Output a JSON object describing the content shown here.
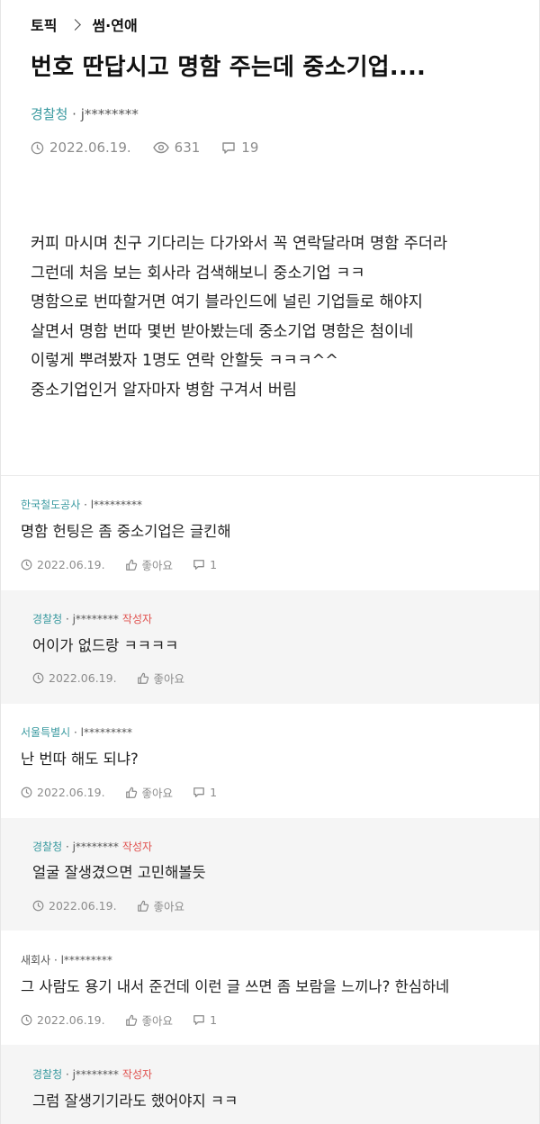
{
  "breadcrumb": {
    "root": "토픽",
    "current": "썸·연애"
  },
  "post": {
    "title": "번호 딴답시고 명함 주는데 중소기업....",
    "company": "경찰청",
    "separator": " · ",
    "user": "j********",
    "date": "2022.06.19.",
    "views": "631",
    "comments": "19",
    "body": [
      "커피 마시며 친구 기다리는 다가와서 꼭 연락달라며 명함 주더라",
      "그런데 처음 보는 회사라 검색해보니 중소기업 ㅋㅋ",
      "명함으로 번따할거면 여기 블라인드에 널린 기업들로 해야지",
      "살면서 명함 번따 몇번 받아봤는데 중소기업 명함은 첨이네",
      "이렇게 뿌려봤자 1명도 연락 안할듯 ㅋㅋㅋ^^",
      "중소기업인거 알자마자 병함 구겨서 버림"
    ]
  },
  "comments": [
    {
      "company": "한국철도공사",
      "user": "l*********",
      "op_label": "",
      "text": "명함 헌팅은 좀 중소기업은 글킨해",
      "date": "2022.06.19.",
      "like_label": "좋아요",
      "reply_count": "1"
    },
    {
      "company": "경찰청",
      "user": "j********",
      "op_label": "작성자",
      "text": "어이가 없드랑 ㅋㅋㅋㅋ",
      "date": "2022.06.19.",
      "like_label": "좋아요",
      "reply_count": ""
    },
    {
      "company": "서울특별시",
      "user": "l*********",
      "op_label": "",
      "text": "난 번따 해도 되냐?",
      "date": "2022.06.19.",
      "like_label": "좋아요",
      "reply_count": "1"
    },
    {
      "company": "경찰청",
      "user": "j********",
      "op_label": "작성자",
      "text": "얼굴 잘생겼으면 고민해볼듯",
      "date": "2022.06.19.",
      "like_label": "좋아요",
      "reply_count": ""
    },
    {
      "company": "새회사",
      "user": "l*********",
      "op_label": "",
      "text": "그 사람도 용기 내서 준건데 이런 글 쓰면 좀 보람을 느끼나? 한심하네",
      "date": "2022.06.19.",
      "like_label": "좋아요",
      "reply_count": "1"
    },
    {
      "company": "경찰청",
      "user": "j********",
      "op_label": "작성자",
      "text": "그럼 잘생기기라도 했어야지 ㅋㅋ",
      "date": "",
      "like_label": "",
      "reply_count": ""
    }
  ],
  "colors": {
    "company": "#3a9aa0",
    "op": "#e0524f",
    "reply_bg": "#f5f5f5"
  },
  "icons": [
    "chevron-right-icon",
    "clock-icon",
    "eye-icon",
    "speech-bubble-icon",
    "thumbs-up-icon"
  ]
}
